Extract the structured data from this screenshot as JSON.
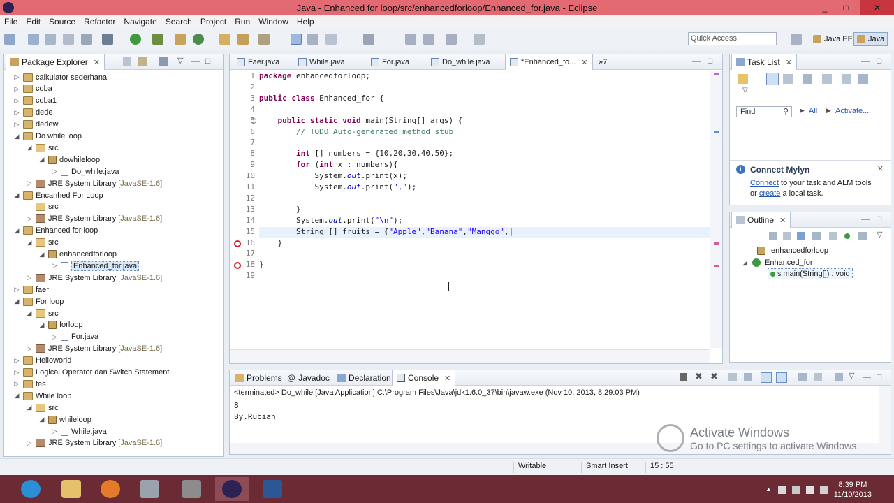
{
  "window": {
    "title": "Java - Enhanced for loop/src/enhancedforloop/Enhanced_for.java - Eclipse",
    "controls": [
      "_",
      "□",
      "✕"
    ]
  },
  "menu": [
    "File",
    "Edit",
    "Source",
    "Refactor",
    "Navigate",
    "Search",
    "Project",
    "Run",
    "Window",
    "Help"
  ],
  "toolbar": {
    "quick_access_placeholder": "Quick Access",
    "perspectives": [
      "Java EE",
      "Java"
    ]
  },
  "package_explorer": {
    "title": "Package Explorer",
    "items": [
      {
        "label": "calkulator sederhana",
        "level": 0,
        "type": "project",
        "twisty": "▷"
      },
      {
        "label": "coba",
        "level": 0,
        "type": "project",
        "twisty": "▷"
      },
      {
        "label": "coba1",
        "level": 0,
        "type": "project",
        "twisty": "▷"
      },
      {
        "label": "dede",
        "level": 0,
        "type": "project",
        "twisty": "▷"
      },
      {
        "label": "dedew",
        "level": 0,
        "type": "project",
        "twisty": "▷"
      },
      {
        "label": "Do while loop",
        "level": 0,
        "type": "project",
        "twisty": "◢"
      },
      {
        "label": "src",
        "level": 1,
        "type": "src",
        "twisty": "◢"
      },
      {
        "label": "dowhileloop",
        "level": 2,
        "type": "pkg",
        "twisty": "◢"
      },
      {
        "label": "Do_while.java",
        "level": 3,
        "type": "file",
        "twisty": "▷"
      },
      {
        "label": "JRE System Library",
        "version": "[JavaSE-1.6]",
        "level": 1,
        "type": "lib",
        "twisty": "▷"
      },
      {
        "label": "Encanhed For Loop",
        "level": 0,
        "type": "project",
        "twisty": "◢"
      },
      {
        "label": "src",
        "level": 1,
        "type": "src",
        "twisty": ""
      },
      {
        "label": "JRE System Library",
        "version": "[JavaSE-1.6]",
        "level": 1,
        "type": "lib",
        "twisty": "▷"
      },
      {
        "label": "Enhanced for loop",
        "level": 0,
        "type": "project",
        "twisty": "◢"
      },
      {
        "label": "src",
        "level": 1,
        "type": "src",
        "twisty": "◢"
      },
      {
        "label": "enhancedforloop",
        "level": 2,
        "type": "pkg",
        "twisty": "◢"
      },
      {
        "label": "Enhanced_for.java",
        "level": 3,
        "type": "file",
        "twisty": "▷",
        "selected": true
      },
      {
        "label": "JRE System Library",
        "version": "[JavaSE-1.6]",
        "level": 1,
        "type": "lib",
        "twisty": "▷"
      },
      {
        "label": "faer",
        "level": 0,
        "type": "project",
        "twisty": "▷"
      },
      {
        "label": "For loop",
        "level": 0,
        "type": "project",
        "twisty": "◢"
      },
      {
        "label": "src",
        "level": 1,
        "type": "src",
        "twisty": "◢"
      },
      {
        "label": "forloop",
        "level": 2,
        "type": "pkg",
        "twisty": "◢"
      },
      {
        "label": "For.java",
        "level": 3,
        "type": "file",
        "twisty": "▷"
      },
      {
        "label": "JRE System Library",
        "version": "[JavaSE-1.6]",
        "level": 1,
        "type": "lib",
        "twisty": "▷"
      },
      {
        "label": "Helloworld",
        "level": 0,
        "type": "project",
        "twisty": "▷"
      },
      {
        "label": "Logical Operator dan Switch Statement",
        "level": 0,
        "type": "project",
        "twisty": "▷"
      },
      {
        "label": "tes",
        "level": 0,
        "type": "project",
        "twisty": "▷"
      },
      {
        "label": "While loop",
        "level": 0,
        "type": "project",
        "twisty": "◢"
      },
      {
        "label": "src",
        "level": 1,
        "type": "src",
        "twisty": "◢"
      },
      {
        "label": "whileloop",
        "level": 2,
        "type": "pkg",
        "twisty": "◢"
      },
      {
        "label": "While.java",
        "level": 3,
        "type": "file",
        "twisty": "▷"
      },
      {
        "label": "JRE System Library",
        "version": "[JavaSE-1.6]",
        "level": 1,
        "type": "lib",
        "twisty": "▷"
      }
    ]
  },
  "editor": {
    "tabs": [
      "Faer.java",
      "While.java",
      "For.java",
      "Do_while.java",
      "*Enhanced_fo...",
      "»7"
    ],
    "active_tab": 4,
    "lines": [
      {
        "n": "1",
        "html": "<span class='kw'>package</span> enhancedforloop;"
      },
      {
        "n": "2",
        "html": ""
      },
      {
        "n": "3",
        "html": "<span class='kw'>public class</span> Enhanced_for {"
      },
      {
        "n": "4",
        "html": ""
      },
      {
        "n": "5",
        "html": "    <span class='kw'>public static void</span> main(String[] args) {"
      },
      {
        "n": "6",
        "html": "        <span class='cmt'>// TODO Auto-generated method stub</span>"
      },
      {
        "n": "7",
        "html": ""
      },
      {
        "n": "8",
        "html": "        <span class='kw'>int</span> [] numbers = {10,20,30,40,50};"
      },
      {
        "n": "9",
        "html": "        <span class='kw'>for</span> (<span class='kw'>int</span> x : numbers){"
      },
      {
        "n": "10",
        "html": "            System.<span class='fld'>out</span>.print(x);"
      },
      {
        "n": "11",
        "html": "            System.<span class='fld'>out</span>.print(<span class='str'>\",\"</span>);"
      },
      {
        "n": "12",
        "html": ""
      },
      {
        "n": "13",
        "html": "        }"
      },
      {
        "n": "14",
        "html": "        System.<span class='fld'>out</span>.print(<span class='str'>\"\\n\"</span>);"
      },
      {
        "n": "15",
        "html": "        String [] fruits = {<span class='str'>\"Apple\"</span>,<span class='str'>\"Banana\"</span>,<span class='str'>\"Manggo\"</span>,|"
      },
      {
        "n": "16",
        "html": "    }"
      },
      {
        "n": "17",
        "html": ""
      },
      {
        "n": "18",
        "html": "}"
      },
      {
        "n": "19",
        "html": ""
      }
    ],
    "error_lines": [
      16,
      18
    ]
  },
  "task_list": {
    "title": "Task List",
    "find_placeholder": "Find",
    "all_label": "All",
    "activate_label": "Activate...",
    "mylyn_title": "Connect Mylyn",
    "mylyn_connect": "Connect",
    "mylyn_text1": " to your task and ALM tools",
    "mylyn_or": "or ",
    "mylyn_create": "create",
    "mylyn_text2": " a local task."
  },
  "outline": {
    "title": "Outline",
    "items": [
      "enhancedforloop",
      "Enhanced_for",
      "main(String[]) : void"
    ]
  },
  "console": {
    "tabs": [
      "Problems",
      "Javadoc",
      "Declaration",
      "Console"
    ],
    "active_tab": 3,
    "header": "<terminated> Do_while [Java Application] C:\\Program Files\\Java\\jdk1.6.0_37\\bin\\javaw.exe (Nov 10, 2013, 8:29:03 PM)",
    "output": [
      "8",
      "By.Rubiah"
    ]
  },
  "status": {
    "writable": "Writable",
    "insert_mode": "Smart Insert",
    "position": "15 : 55"
  },
  "watermark": {
    "heading": "Activate Windows",
    "sub": "Go to PC settings to activate Windows."
  },
  "taskbar": {
    "time": "8:39 PM",
    "date": "11/10/2013"
  }
}
